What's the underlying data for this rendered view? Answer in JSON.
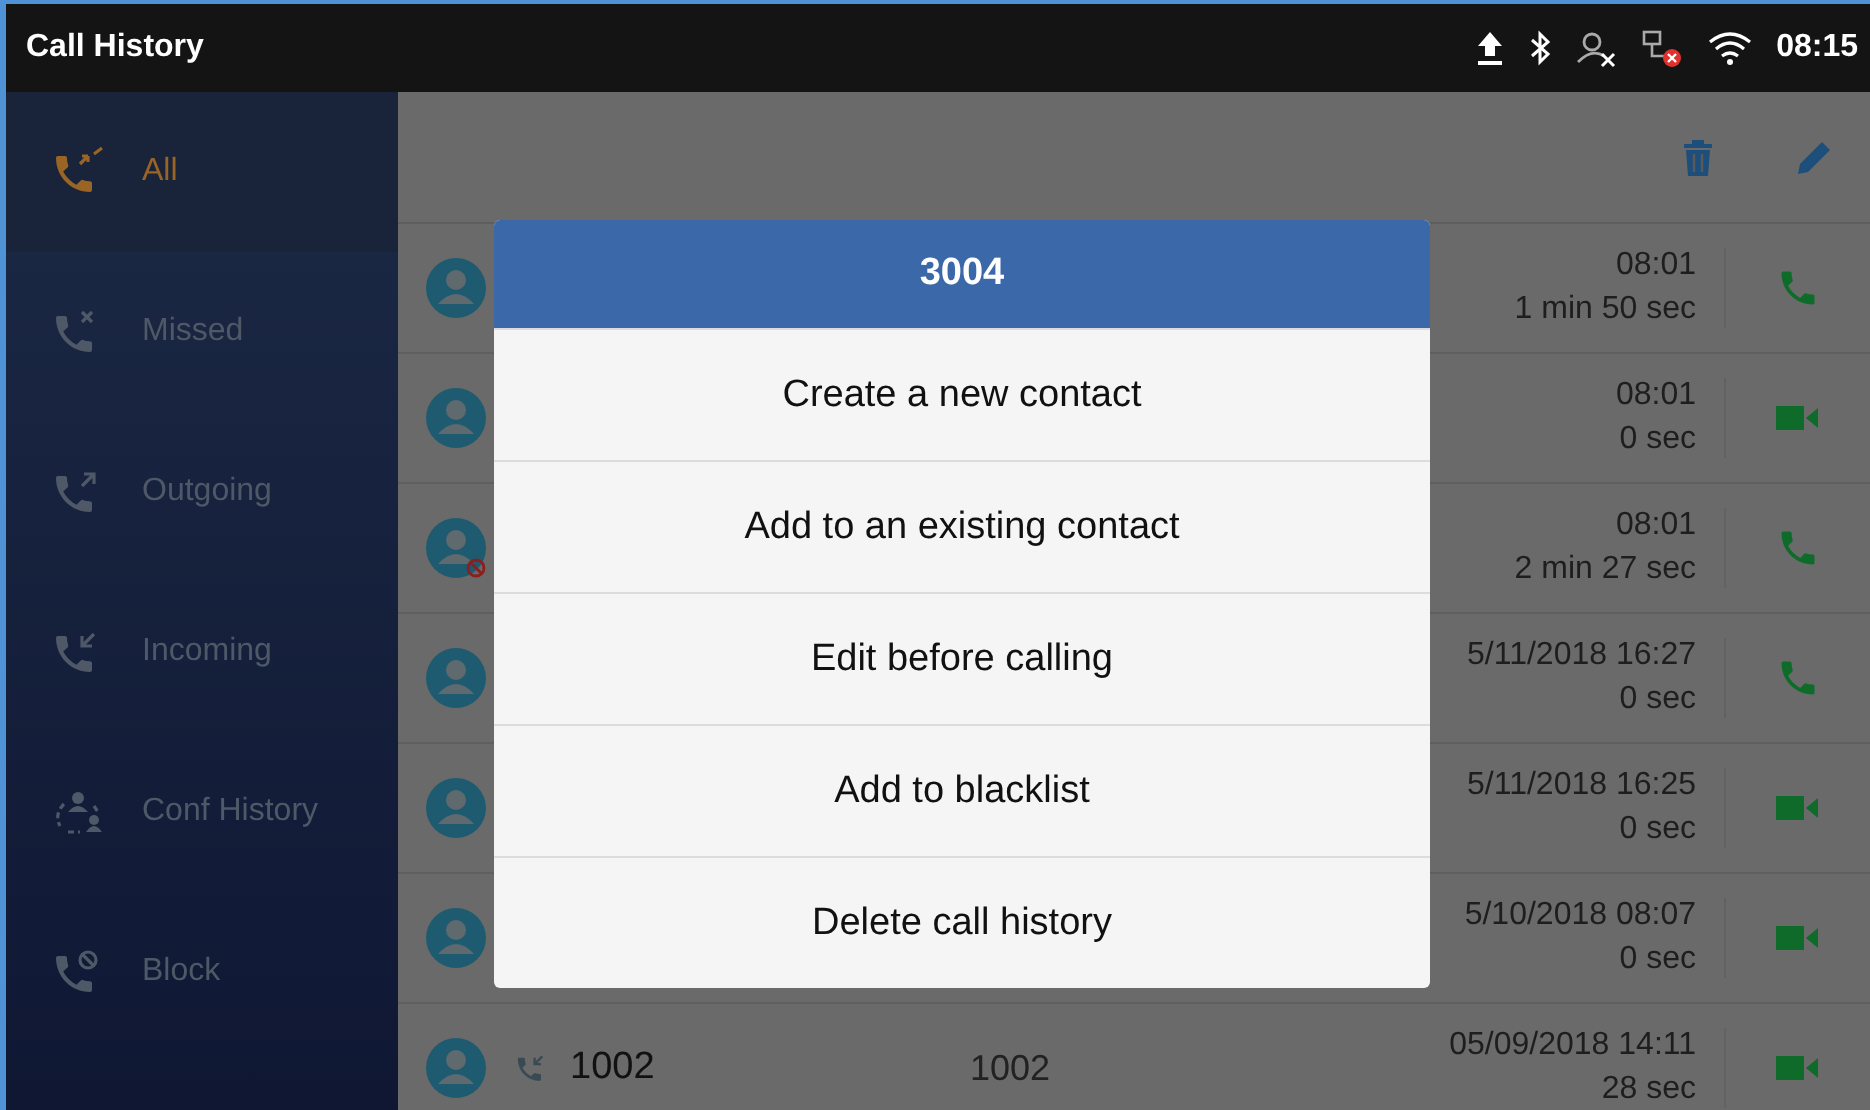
{
  "status_bar": {
    "title": "Call History",
    "time": "08:15"
  },
  "sidebar": {
    "items": [
      {
        "label": "All",
        "kind": "all",
        "selected": true
      },
      {
        "label": "Missed",
        "kind": "missed",
        "selected": false
      },
      {
        "label": "Outgoing",
        "kind": "outgoing",
        "selected": false
      },
      {
        "label": "Incoming",
        "kind": "incoming",
        "selected": false
      },
      {
        "label": "Conf History",
        "kind": "conference",
        "selected": false
      },
      {
        "label": "Block",
        "kind": "block",
        "selected": false
      }
    ]
  },
  "calls": [
    {
      "time": "08:01",
      "duration": "1 min 50 sec",
      "kind": "audio",
      "blocked": false
    },
    {
      "time": "08:01",
      "duration": "0 sec",
      "kind": "video",
      "blocked": false
    },
    {
      "time": "08:01",
      "duration": "2 min 27 sec",
      "kind": "audio",
      "blocked": true
    },
    {
      "time": "5/11/2018 16:27",
      "duration": "0 sec",
      "kind": "audio",
      "blocked": false
    },
    {
      "time": "5/11/2018 16:25",
      "duration": "0 sec",
      "kind": "video",
      "blocked": false
    },
    {
      "time": "5/10/2018 08:07",
      "duration": "0 sec",
      "kind": "video",
      "blocked": false
    },
    {
      "name": "1002",
      "number": "1002",
      "time": "05/09/2018 14:11",
      "duration": "28 sec",
      "kind": "video",
      "blocked": false
    }
  ],
  "dialog": {
    "title": "3004",
    "options": [
      "Create a new contact",
      "Add to an existing contact",
      "Edit before calling",
      "Add to blacklist",
      "Delete call history"
    ]
  }
}
